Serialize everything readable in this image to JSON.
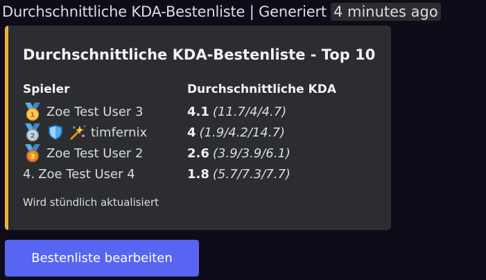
{
  "header": {
    "title": "Durchschnittliche KDA-Bestenliste | Generiert",
    "timestamp": "4 minutes ago"
  },
  "embed": {
    "accent_color": "#f0b232",
    "title": "Durchschnittliche KDA-Bestenliste - Top 10",
    "column_player": "Spieler",
    "column_kda": "Durchschnittliche KDA",
    "rows": [
      {
        "rank_icon": "gold-medal-icon",
        "name": "Zoe Test User 3",
        "kda": "4.1",
        "detail": "(11.7/4/4.7)"
      },
      {
        "rank_icon": "silver-medal-icon",
        "name": "timfernix",
        "kda": "4",
        "detail": "(1.9/4.2/14.7)"
      },
      {
        "rank_icon": "bronze-medal-icon",
        "name": "Zoe Test User 2",
        "kda": "2.6",
        "detail": "(3.9/3.9/6.1)"
      },
      {
        "rank_label": "4.",
        "name": "Zoe Test User 4",
        "kda": "1.8",
        "detail": "(5.7/7.3/7.7)"
      }
    ],
    "footer": "Wird stündlich aktualisiert"
  },
  "button": {
    "label": "Bestenliste bearbeiten",
    "color": "#5865f2"
  }
}
